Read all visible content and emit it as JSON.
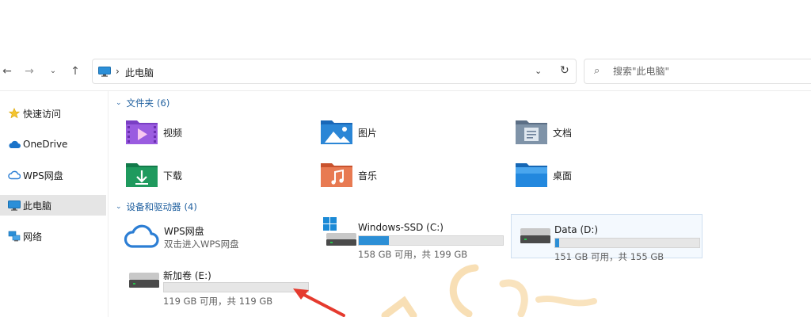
{
  "nav": {
    "back_icon": "arrow-left-icon",
    "forward_icon": "arrow-right-icon",
    "recent_icon": "chevron-down-icon",
    "up_icon": "arrow-up-icon"
  },
  "address": {
    "separator": "›",
    "crumb": "此电脑",
    "dropdown": "⌄",
    "refresh": "↻"
  },
  "search": {
    "placeholder": "搜索\"此电脑\""
  },
  "sidebar": {
    "items": [
      {
        "label": "快速访问",
        "icon": "star-icon"
      },
      {
        "label": "OneDrive",
        "icon": "cloud-icon"
      },
      {
        "label": "WPS网盘",
        "icon": "wps-cloud-icon"
      },
      {
        "label": "此电脑",
        "icon": "computer-icon",
        "selected": true
      },
      {
        "label": "网络",
        "icon": "network-icon"
      }
    ]
  },
  "folders_section": {
    "title": "文件夹",
    "count": "(6)",
    "items": [
      {
        "label": "视频",
        "icon": "videos-folder-icon"
      },
      {
        "label": "图片",
        "icon": "pictures-folder-icon"
      },
      {
        "label": "文档",
        "icon": "documents-folder-icon"
      },
      {
        "label": "下载",
        "icon": "downloads-folder-icon"
      },
      {
        "label": "音乐",
        "icon": "music-folder-icon"
      },
      {
        "label": "桌面",
        "icon": "desktop-folder-icon"
      }
    ]
  },
  "devices_section": {
    "title": "设备和驱动器",
    "count": "(4)",
    "wps": {
      "label": "WPS网盘",
      "sub": "双击进入WPS网盘"
    },
    "drives": [
      {
        "label": "Windows-SSD (C:)",
        "size": "158 GB 可用，共 199 GB",
        "used_fraction": 0.21
      },
      {
        "label": "Data (D:)",
        "size": "151 GB 可用，共 155 GB",
        "used_fraction": 0.03
      },
      {
        "label": "新加卷 (E:)",
        "size": "119 GB 可用，共 119 GB",
        "used_fraction": 0.0
      }
    ]
  },
  "colors": {
    "accent": "#2c8fd6",
    "section_header": "#1d5e9e",
    "annotation_arrow": "#e53a2e"
  }
}
